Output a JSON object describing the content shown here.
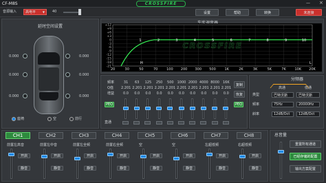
{
  "app": {
    "title": "CF-M8S",
    "logo": "CROSSFIRE"
  },
  "toolbar": {
    "source_label": "音源输入",
    "source_value": "高电平",
    "volume_value": "40",
    "volume_fraction": 0.85,
    "btn_settings": "设置",
    "btn_help": "帮助",
    "btn_mode": "转换",
    "btn_alert": "未连接"
  },
  "eq": {
    "title": "车库调音器",
    "y_labels": [
      "+12",
      "+9",
      "+6",
      "+3",
      "0",
      "-3",
      "-6",
      "-9",
      "-12",
      "-15",
      "-18",
      "-21"
    ],
    "x_labels": [
      "20",
      "30",
      "50",
      "70",
      "100",
      "200",
      "300",
      "500",
      "1K",
      "2K",
      "3K",
      "5K",
      "7K",
      "10K",
      "20K"
    ],
    "channel_points": [
      "1",
      "2",
      "3",
      "4",
      "5",
      "6",
      "7",
      "8",
      "9",
      "10"
    ],
    "x_axis_label": "L",
    "low_cut_label": "H"
  },
  "delay": {
    "title": "延时空间设置",
    "left_value": "0.000",
    "right_value": "0.000",
    "rear_left": "0.000",
    "rear_right": "0.000",
    "left2": "0.000",
    "right2": "0.000",
    "opt_a": "座椅",
    "opt_b": "空",
    "opt_c": "前行"
  },
  "band": {
    "labels": [
      "频率",
      "Q值",
      "增益"
    ],
    "freqs": [
      "31",
      "63",
      "125",
      "250",
      "500",
      "1000",
      "2000",
      "4000",
      "8000",
      "16K"
    ],
    "q": [
      "2.201",
      "2.201",
      "2.201",
      "2.201",
      "2.201",
      "2.201",
      "2.201",
      "2.201",
      "2.201",
      "2.201"
    ],
    "gain": [
      "0.0",
      "0.0",
      "0.0",
      "0.0",
      "0.0",
      "0.0",
      "0.0",
      "0.0",
      "0.0",
      "0.0"
    ],
    "btn_left": "PEQ",
    "btn_right": "PEQ",
    "reset": "直通",
    "btn_copy": "复制",
    "btn_reset": "恢复"
  },
  "xover": {
    "title": "分频器",
    "high_title": "高通",
    "low_title": "低通",
    "high_type_label": "类型",
    "high_type": "巴特沃斯",
    "low_type": "巴特沃斯",
    "high_freq_label": "频率",
    "high_freq": "75Hz",
    "low_freq": "20000Hz",
    "high_slope_label": "斜率",
    "high_slope": "12dB/Oct",
    "low_slope": "12dB/Oct"
  },
  "channels": [
    {
      "tab": "CH1",
      "name": "前置左高音",
      "on": "开启",
      "mute": "静音"
    },
    {
      "tab": "CH2",
      "name": "前置左中音",
      "on": "开启",
      "mute": "静音"
    },
    {
      "tab": "CH3",
      "name": "前置左全频",
      "on": "开启",
      "mute": "静音"
    },
    {
      "tab": "CH4",
      "name": "前置右全频",
      "on": "开启",
      "mute": "静音"
    },
    {
      "tab": "CH5",
      "name": "空",
      "on": "开启",
      "mute": "静音"
    },
    {
      "tab": "CH6",
      "name": "空",
      "on": "开启",
      "mute": "静音"
    },
    {
      "tab": "CH7",
      "name": "左超低频",
      "on": "开启",
      "mute": "静音"
    },
    {
      "tab": "CH8",
      "name": "右超低频",
      "on": "开启",
      "mute": "静音"
    }
  ],
  "presets": {
    "title": "总音量",
    "btn_load": "重置所有通道",
    "btn_save": "已经存储的配置",
    "btn_export": "输出方案配置"
  },
  "colors": {
    "accent": "#2e8b3e",
    "curve": "#39ff5a",
    "alert": "#d9302c",
    "knob": "#1e88e5"
  }
}
